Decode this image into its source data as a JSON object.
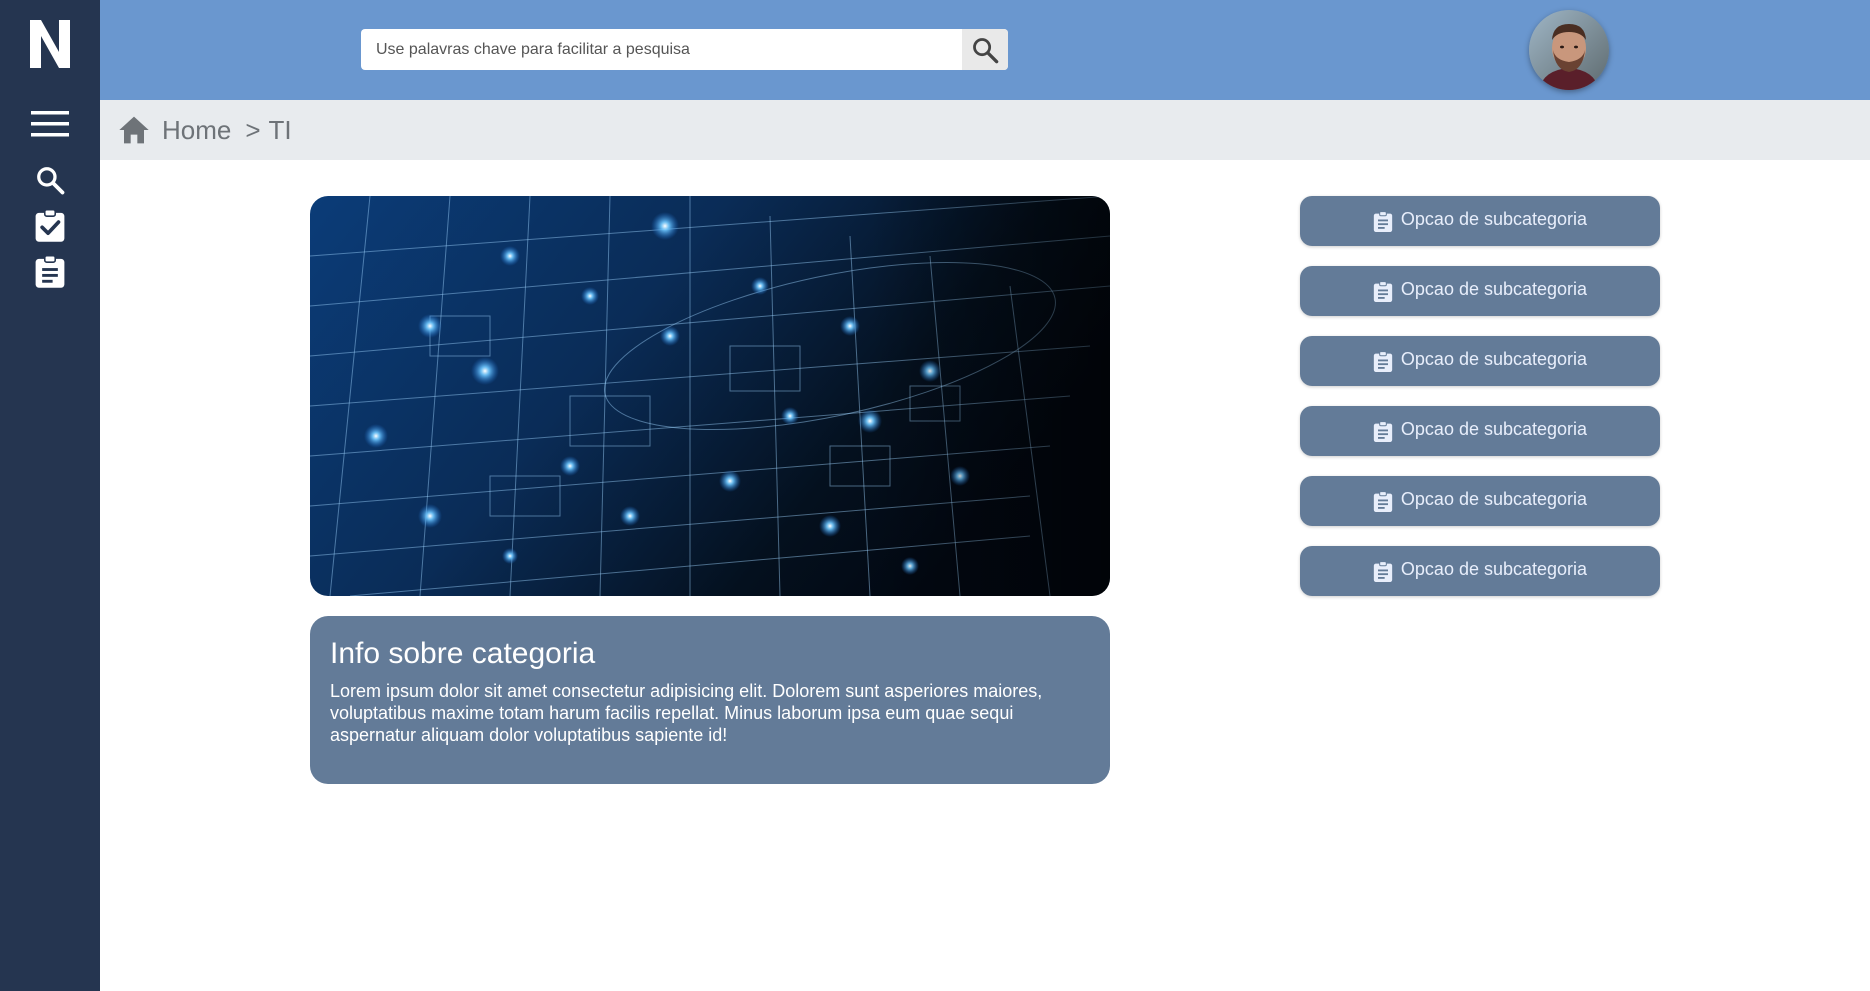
{
  "sidebar": {
    "logo_letter": "N",
    "icons": [
      "menu-icon",
      "search-icon",
      "assignment-check-icon",
      "assignment-icon"
    ]
  },
  "header": {
    "search": {
      "placeholder": "Use palavras chave para facilitar a pesquisa",
      "value": ""
    }
  },
  "breadcrumb": {
    "home": "Home",
    "separator": ">",
    "current": "TI"
  },
  "info": {
    "title": "Info sobre categoria",
    "body": "Lorem ipsum dolor sit amet consectetur adipisicing elit. Dolorem sunt asperiores maiores, voluptatibus maxime totam harum facilis repellat. Minus laborum ipsa eum quae sequi aspernatur aliquam dolor voluptatibus sapiente id!"
  },
  "subcategories": [
    {
      "label": "Opcao de subcategoria"
    },
    {
      "label": "Opcao de subcategoria"
    },
    {
      "label": "Opcao de subcategoria"
    },
    {
      "label": "Opcao de subcategoria"
    },
    {
      "label": "Opcao de subcategoria"
    },
    {
      "label": "Opcao de subcategoria"
    }
  ],
  "colors": {
    "sidebar": "#253550",
    "topbar": "#6a97cf",
    "card": "#637b98",
    "breadcrumb_bg": "#e8ebee"
  }
}
